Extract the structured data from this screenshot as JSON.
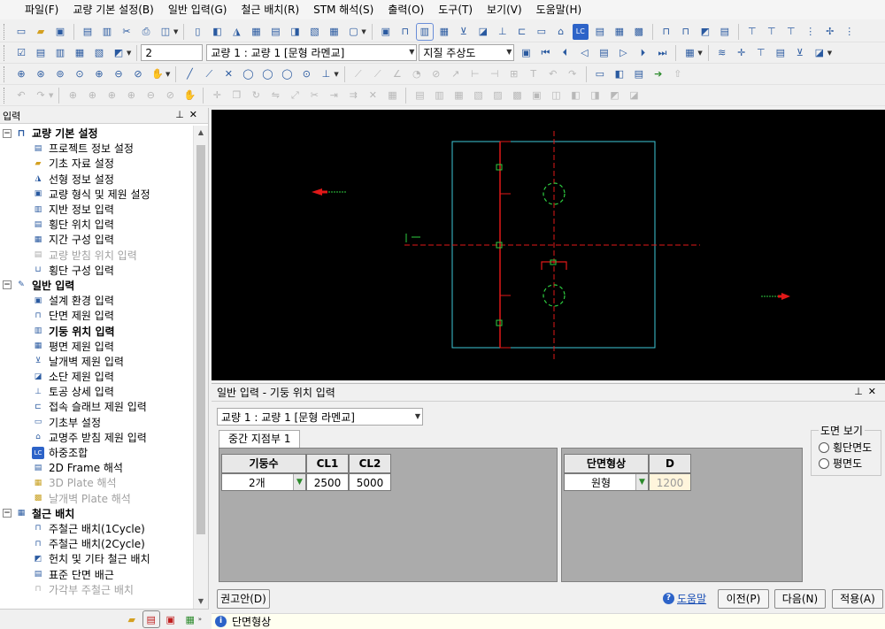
{
  "menu": [
    "파일(F)",
    "교량 기본 설정(B)",
    "일반 입력(G)",
    "철근 배치(R)",
    "STM 해석(S)",
    "출력(O)",
    "도구(T)",
    "보기(V)",
    "도움말(H)"
  ],
  "toolbar2": {
    "number_value": "2",
    "bridge_select": "교량 1 : 교량 1 [문형 라멘교]",
    "display_select": "지질 주상도"
  },
  "left_panel": {
    "title": "입력",
    "groups": [
      {
        "label": "교량 기본 설정",
        "items": [
          {
            "label": "프로젝트 정보 설정",
            "enabled": true
          },
          {
            "label": "기초 자료 설정",
            "enabled": true
          },
          {
            "label": "선형 정보 설정",
            "enabled": true
          },
          {
            "label": "교량 형식 및 제원 설정",
            "enabled": true
          },
          {
            "label": "지반 정보 입력",
            "enabled": true
          },
          {
            "label": "횡단 위치 입력",
            "enabled": true
          },
          {
            "label": "지간 구성 입력",
            "enabled": true
          },
          {
            "label": "교량 받침 위치 입력",
            "enabled": false
          },
          {
            "label": "횡단 구성 입력",
            "enabled": true
          }
        ]
      },
      {
        "label": "일반 입력",
        "items": [
          {
            "label": "설계 환경 입력",
            "enabled": true
          },
          {
            "label": "단면 제원 입력",
            "enabled": true
          },
          {
            "label": "기둥 위치 입력",
            "enabled": true,
            "selected": true
          },
          {
            "label": "평면 제원 입력",
            "enabled": true
          },
          {
            "label": "날개벽 제원 입력",
            "enabled": true
          },
          {
            "label": "소단 제원 입력",
            "enabled": true
          },
          {
            "label": "토공 상세 입력",
            "enabled": true
          },
          {
            "label": "접속 슬래브 제원 입력",
            "enabled": true
          },
          {
            "label": "기초부 설정",
            "enabled": true
          },
          {
            "label": "교명주 받침 제원 입력",
            "enabled": true
          },
          {
            "label": "하중조합",
            "enabled": true
          },
          {
            "label": "2D Frame 해석",
            "enabled": true
          },
          {
            "label": "3D Plate 해석",
            "enabled": false
          },
          {
            "label": "날개벽 Plate 해석",
            "enabled": false
          }
        ]
      },
      {
        "label": "철근 배치",
        "items": [
          {
            "label": "주철근 배치(1Cycle)",
            "enabled": true
          },
          {
            "label": "주철근 배치(2Cycle)",
            "enabled": true
          },
          {
            "label": "헌치 및 기타 철근 배치",
            "enabled": true
          },
          {
            "label": "표준 단면 배근",
            "enabled": true
          },
          {
            "label": "가각부 주철근 배치",
            "enabled": false
          }
        ]
      }
    ]
  },
  "dock": {
    "title": "일반 입력 - 기둥 위치 입력",
    "bridge_select": "교량 1 : 교량 1 [문형 라멘교]",
    "tab": "중간 지점부 1",
    "left_table": {
      "headers": [
        "기둥수",
        "CL1",
        "CL2"
      ],
      "row": {
        "count": "2개",
        "cl1": "2500",
        "cl2": "5000"
      }
    },
    "right_table": {
      "headers": [
        "단면형상",
        "D"
      ],
      "row": {
        "shape": "원형",
        "d": "1200"
      }
    },
    "view_group": {
      "label": "도면 보기",
      "options": [
        "횡단면도",
        "평면도"
      ]
    },
    "buttons": {
      "recommend": "권고안(D)",
      "help": "도움말",
      "prev": "이전(P)",
      "next": "다음(N)",
      "apply": "적용(A)"
    }
  },
  "status": {
    "text": "단면형상"
  },
  "colors": {
    "viewport_bg": "#000000",
    "slab_outline": "#3ec8d8",
    "centerline": "#e01818",
    "column": "#2ecc40"
  }
}
